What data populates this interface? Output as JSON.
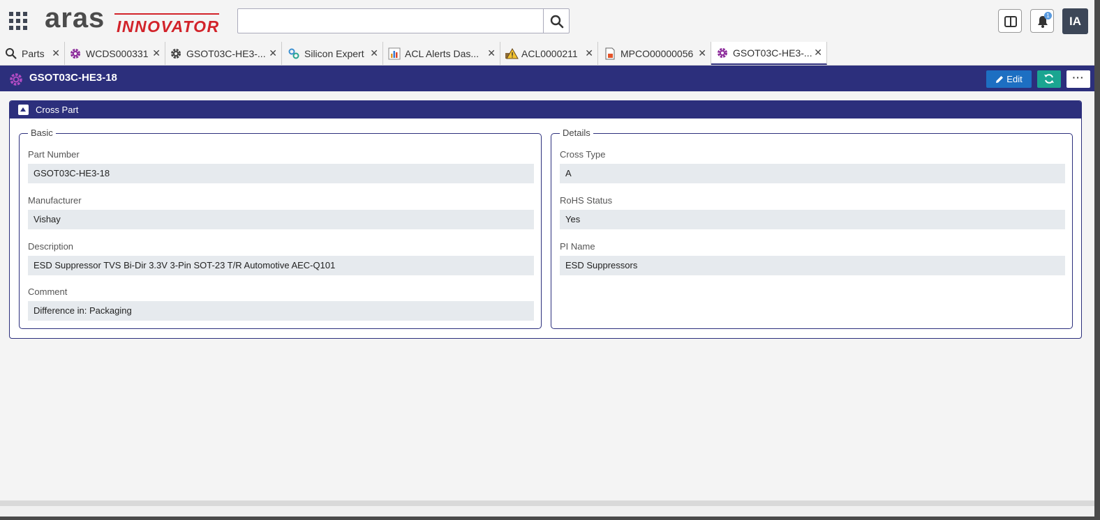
{
  "header": {
    "logo_primary": "aras",
    "logo_secondary": "INNOVATOR",
    "search_placeholder": "",
    "notification_count": "1",
    "user_initials": "IA"
  },
  "tabs": [
    {
      "label": "Parts",
      "icon": "search-icon"
    },
    {
      "label": "WCDS000331",
      "icon": "gear-icon"
    },
    {
      "label": "GSOT03C-HE3-...",
      "icon": "gear-icon"
    },
    {
      "label": "Silicon Expert",
      "icon": "gears-icon"
    },
    {
      "label": "ACL Alerts Das...",
      "icon": "bar-chart-icon"
    },
    {
      "label": "ACL0000211",
      "icon": "warning-icon"
    },
    {
      "label": "MPCO00000056",
      "icon": "document-icon"
    },
    {
      "label": "GSOT03C-HE3-...",
      "icon": "gear-icon",
      "active": true
    }
  ],
  "titlebar": {
    "title": "GSOT03C-HE3-18",
    "edit_label": "Edit",
    "more_label": "···"
  },
  "section": {
    "title": "Cross Part",
    "basic": {
      "legend": "Basic",
      "part_number_label": "Part Number",
      "part_number_value": "GSOT03C-HE3-18",
      "manufacturer_label": "Manufacturer",
      "manufacturer_value": "Vishay",
      "description_label": "Description",
      "description_value": "ESD Suppressor TVS Bi-Dir 3.3V 3-Pin SOT-23 T/R Automotive AEC-Q101",
      "comment_label": "Comment",
      "comment_value": "Difference in: Packaging"
    },
    "details": {
      "legend": "Details",
      "cross_type_label": "Cross Type",
      "cross_type_value": "A",
      "rohs_label": "RoHS Status",
      "rohs_value": "Yes",
      "pi_name_label": "PI Name",
      "pi_name_value": "ESD Suppressors"
    }
  },
  "colors": {
    "brand_navy": "#2c2f7c",
    "edit_blue": "#1d6fc2",
    "refresh_teal": "#1aa591",
    "logo_red": "#d2232a"
  }
}
